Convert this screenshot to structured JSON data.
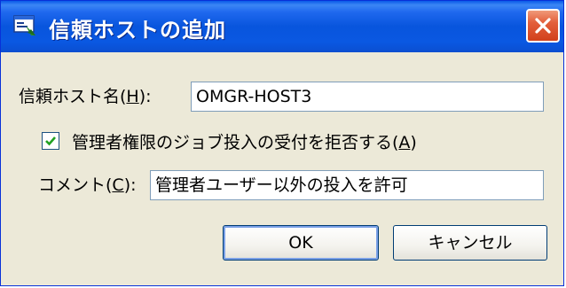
{
  "window": {
    "title": "信頼ホストの追加",
    "title_icon": "add-host-icon",
    "close_icon": "close-icon"
  },
  "form": {
    "host_label_main": "信頼ホスト名(",
    "host_label_key": "H",
    "host_label_end": "):",
    "host_value": "OMGR-HOST3",
    "reject_checkbox_checked": true,
    "reject_label_main": "管理者権限のジョブ投入の受付を拒否する(",
    "reject_label_key": "A",
    "reject_label_end": ")",
    "comment_label_main": "コメント(",
    "comment_label_key": "C",
    "comment_label_end": "):",
    "comment_value": "管理者ユーザー以外の投入を許可"
  },
  "buttons": {
    "ok_label": "OK",
    "cancel_label": "キャンセル"
  },
  "colors": {
    "titlebar": "#0855dd",
    "dialog_background": "#ece9d8",
    "close_button": "#d1411c",
    "input_border": "#7f9db9"
  }
}
